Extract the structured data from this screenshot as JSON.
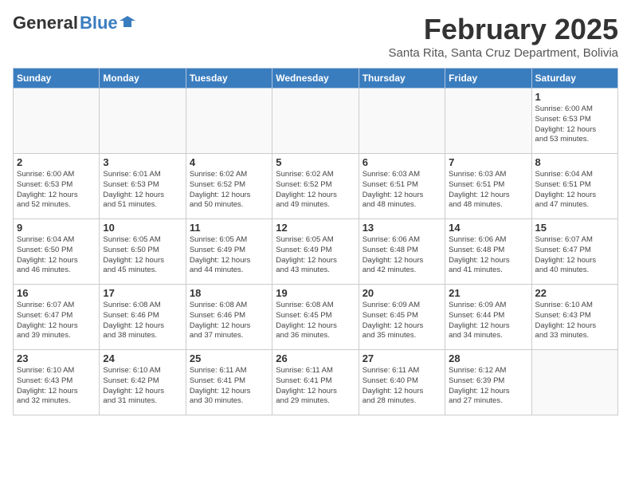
{
  "header": {
    "logo_general": "General",
    "logo_blue": "Blue",
    "title": "February 2025",
    "location": "Santa Rita, Santa Cruz Department, Bolivia"
  },
  "weekdays": [
    "Sunday",
    "Monday",
    "Tuesday",
    "Wednesday",
    "Thursday",
    "Friday",
    "Saturday"
  ],
  "weeks": [
    [
      {
        "day": "",
        "info": ""
      },
      {
        "day": "",
        "info": ""
      },
      {
        "day": "",
        "info": ""
      },
      {
        "day": "",
        "info": ""
      },
      {
        "day": "",
        "info": ""
      },
      {
        "day": "",
        "info": ""
      },
      {
        "day": "1",
        "info": "Sunrise: 6:00 AM\nSunset: 6:53 PM\nDaylight: 12 hours\nand 53 minutes."
      }
    ],
    [
      {
        "day": "2",
        "info": "Sunrise: 6:00 AM\nSunset: 6:53 PM\nDaylight: 12 hours\nand 52 minutes."
      },
      {
        "day": "3",
        "info": "Sunrise: 6:01 AM\nSunset: 6:53 PM\nDaylight: 12 hours\nand 51 minutes."
      },
      {
        "day": "4",
        "info": "Sunrise: 6:02 AM\nSunset: 6:52 PM\nDaylight: 12 hours\nand 50 minutes."
      },
      {
        "day": "5",
        "info": "Sunrise: 6:02 AM\nSunset: 6:52 PM\nDaylight: 12 hours\nand 49 minutes."
      },
      {
        "day": "6",
        "info": "Sunrise: 6:03 AM\nSunset: 6:51 PM\nDaylight: 12 hours\nand 48 minutes."
      },
      {
        "day": "7",
        "info": "Sunrise: 6:03 AM\nSunset: 6:51 PM\nDaylight: 12 hours\nand 48 minutes."
      },
      {
        "day": "8",
        "info": "Sunrise: 6:04 AM\nSunset: 6:51 PM\nDaylight: 12 hours\nand 47 minutes."
      }
    ],
    [
      {
        "day": "9",
        "info": "Sunrise: 6:04 AM\nSunset: 6:50 PM\nDaylight: 12 hours\nand 46 minutes."
      },
      {
        "day": "10",
        "info": "Sunrise: 6:05 AM\nSunset: 6:50 PM\nDaylight: 12 hours\nand 45 minutes."
      },
      {
        "day": "11",
        "info": "Sunrise: 6:05 AM\nSunset: 6:49 PM\nDaylight: 12 hours\nand 44 minutes."
      },
      {
        "day": "12",
        "info": "Sunrise: 6:05 AM\nSunset: 6:49 PM\nDaylight: 12 hours\nand 43 minutes."
      },
      {
        "day": "13",
        "info": "Sunrise: 6:06 AM\nSunset: 6:48 PM\nDaylight: 12 hours\nand 42 minutes."
      },
      {
        "day": "14",
        "info": "Sunrise: 6:06 AM\nSunset: 6:48 PM\nDaylight: 12 hours\nand 41 minutes."
      },
      {
        "day": "15",
        "info": "Sunrise: 6:07 AM\nSunset: 6:47 PM\nDaylight: 12 hours\nand 40 minutes."
      }
    ],
    [
      {
        "day": "16",
        "info": "Sunrise: 6:07 AM\nSunset: 6:47 PM\nDaylight: 12 hours\nand 39 minutes."
      },
      {
        "day": "17",
        "info": "Sunrise: 6:08 AM\nSunset: 6:46 PM\nDaylight: 12 hours\nand 38 minutes."
      },
      {
        "day": "18",
        "info": "Sunrise: 6:08 AM\nSunset: 6:46 PM\nDaylight: 12 hours\nand 37 minutes."
      },
      {
        "day": "19",
        "info": "Sunrise: 6:08 AM\nSunset: 6:45 PM\nDaylight: 12 hours\nand 36 minutes."
      },
      {
        "day": "20",
        "info": "Sunrise: 6:09 AM\nSunset: 6:45 PM\nDaylight: 12 hours\nand 35 minutes."
      },
      {
        "day": "21",
        "info": "Sunrise: 6:09 AM\nSunset: 6:44 PM\nDaylight: 12 hours\nand 34 minutes."
      },
      {
        "day": "22",
        "info": "Sunrise: 6:10 AM\nSunset: 6:43 PM\nDaylight: 12 hours\nand 33 minutes."
      }
    ],
    [
      {
        "day": "23",
        "info": "Sunrise: 6:10 AM\nSunset: 6:43 PM\nDaylight: 12 hours\nand 32 minutes."
      },
      {
        "day": "24",
        "info": "Sunrise: 6:10 AM\nSunset: 6:42 PM\nDaylight: 12 hours\nand 31 minutes."
      },
      {
        "day": "25",
        "info": "Sunrise: 6:11 AM\nSunset: 6:41 PM\nDaylight: 12 hours\nand 30 minutes."
      },
      {
        "day": "26",
        "info": "Sunrise: 6:11 AM\nSunset: 6:41 PM\nDaylight: 12 hours\nand 29 minutes."
      },
      {
        "day": "27",
        "info": "Sunrise: 6:11 AM\nSunset: 6:40 PM\nDaylight: 12 hours\nand 28 minutes."
      },
      {
        "day": "28",
        "info": "Sunrise: 6:12 AM\nSunset: 6:39 PM\nDaylight: 12 hours\nand 27 minutes."
      },
      {
        "day": "",
        "info": ""
      }
    ]
  ]
}
